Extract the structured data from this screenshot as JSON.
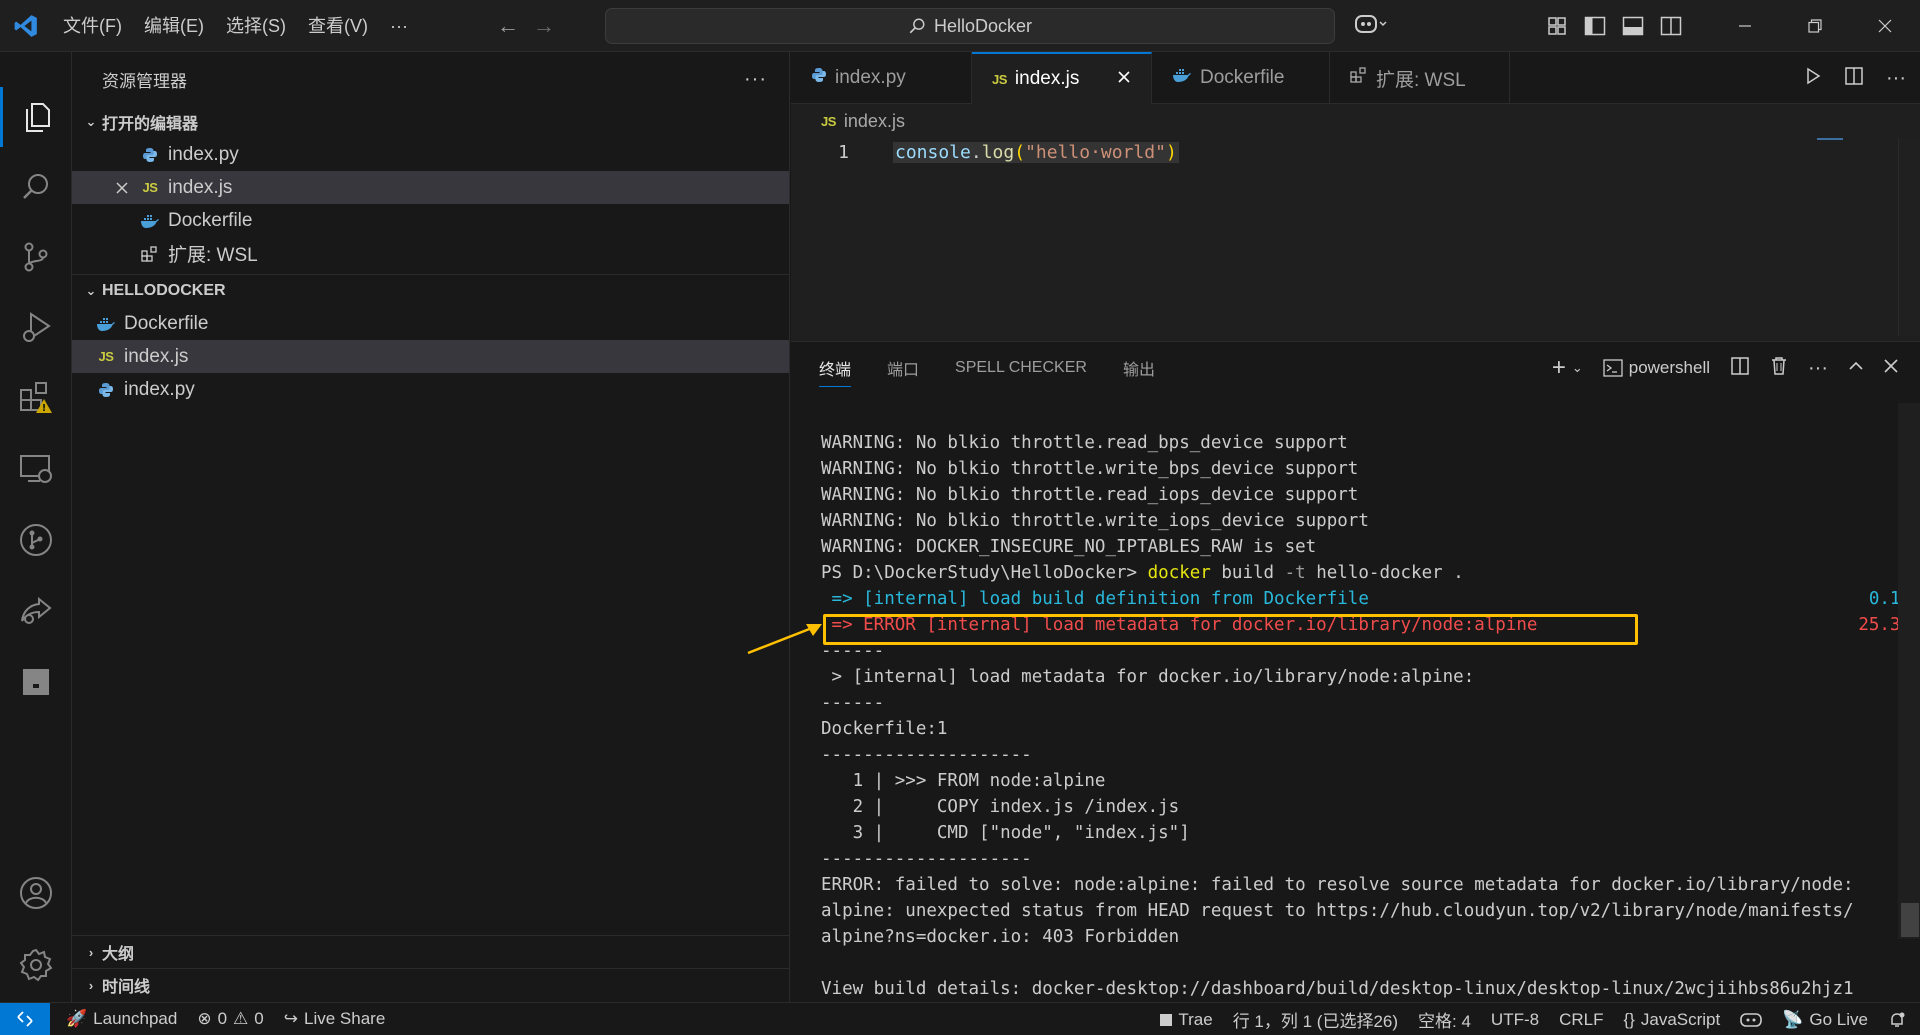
{
  "titlebar": {
    "menus": [
      "文件(F)",
      "编辑(E)",
      "选择(S)",
      "查看(V)",
      "···"
    ],
    "search_text": "HelloDocker"
  },
  "sidebar": {
    "title": "资源管理器",
    "open_editors": {
      "title": "打开的编辑器",
      "items": [
        {
          "name": "index.py",
          "icon": "python-icon"
        },
        {
          "name": "index.js",
          "icon": "js-icon",
          "badge": "JS"
        },
        {
          "name": "Dockerfile",
          "icon": "docker-icon"
        },
        {
          "name": "扩展: WSL",
          "icon": "extensions-icon"
        }
      ]
    },
    "workspace": {
      "title": "HELLODOCKER",
      "items": [
        {
          "name": "Dockerfile",
          "icon": "docker-icon"
        },
        {
          "name": "index.js",
          "icon": "js-icon",
          "badge": "JS"
        },
        {
          "name": "index.py",
          "icon": "python-icon"
        }
      ]
    },
    "outline": "大纲",
    "timeline": "时间线"
  },
  "tabs": [
    {
      "label": "index.py",
      "icon": "python-icon"
    },
    {
      "label": "index.js",
      "icon": "js-icon",
      "badge": "JS",
      "active": true
    },
    {
      "label": "Dockerfile",
      "icon": "docker-icon"
    },
    {
      "label": "扩展: WSL",
      "icon": "extensions-icon"
    }
  ],
  "breadcrumb": {
    "badge": "JS",
    "file": "index.js"
  },
  "editor": {
    "line_number": "1",
    "code_obj": "console",
    "code_dot": ".",
    "code_fn": "log",
    "code_open": "(",
    "code_str": "\"hello·world\"",
    "code_close": ")"
  },
  "panel": {
    "tabs": [
      "终端",
      "端口",
      "SPELL CHECKER",
      "输出"
    ],
    "shell": "powershell"
  },
  "terminal": {
    "lines": [
      "WARNING: No blkio throttle.read_bps_device support",
      "WARNING: No blkio throttle.write_bps_device support",
      "WARNING: No blkio throttle.read_iops_device support",
      "WARNING: No blkio throttle.write_iops_device support",
      "WARNING: DOCKER_INSECURE_NO_IPTABLES_RAW is set"
    ],
    "prompt": "PS D:\\DockerStudy\\HelloDocker> ",
    "cmd": "docker",
    "cmd_args": " build ",
    "cmd_flag": "-t",
    "cmd_rest": " hello-docker .",
    "step1": " => [internal] load build definition from Dockerfile",
    "step1_time": "0.1s",
    "step2": " => ERROR [internal] load metadata for docker.io/library/node:alpine",
    "step2_time": "25.3s",
    "rest": [
      "------",
      " > [internal] load metadata for docker.io/library/node:alpine:",
      "------",
      "Dockerfile:1",
      "--------------------",
      "   1 | >>> FROM node:alpine",
      "   2 |     COPY index.js /index.js",
      "   3 |     CMD [\"node\", \"index.js\"]",
      "--------------------",
      "ERROR: failed to solve: node:alpine: failed to resolve source metadata for docker.io/library/node:",
      "alpine: unexpected status from HEAD request to https://hub.cloudyun.top/v2/library/node/manifests/",
      "alpine?ns=docker.io: 403 Forbidden",
      "",
      "View build details: docker-desktop://dashboard/build/desktop-linux/desktop-linux/2wcjiihbs86u2hjz1"
    ]
  },
  "statusbar": {
    "launchpad": "Launchpad",
    "errors": "0",
    "warnings": "0",
    "live_share": "Live Share",
    "trae": "Trae",
    "position": "行 1，列 1 (已选择26)",
    "spaces": "空格: 4",
    "encoding": "UTF-8",
    "eol": "CRLF",
    "language": "JavaScript",
    "go_live": "Go Live"
  },
  "colors": {
    "accent": "#0078d4",
    "highlight_box": "#ffc000",
    "error_red": "#f14c4c",
    "info_cyan": "#29b8db"
  }
}
